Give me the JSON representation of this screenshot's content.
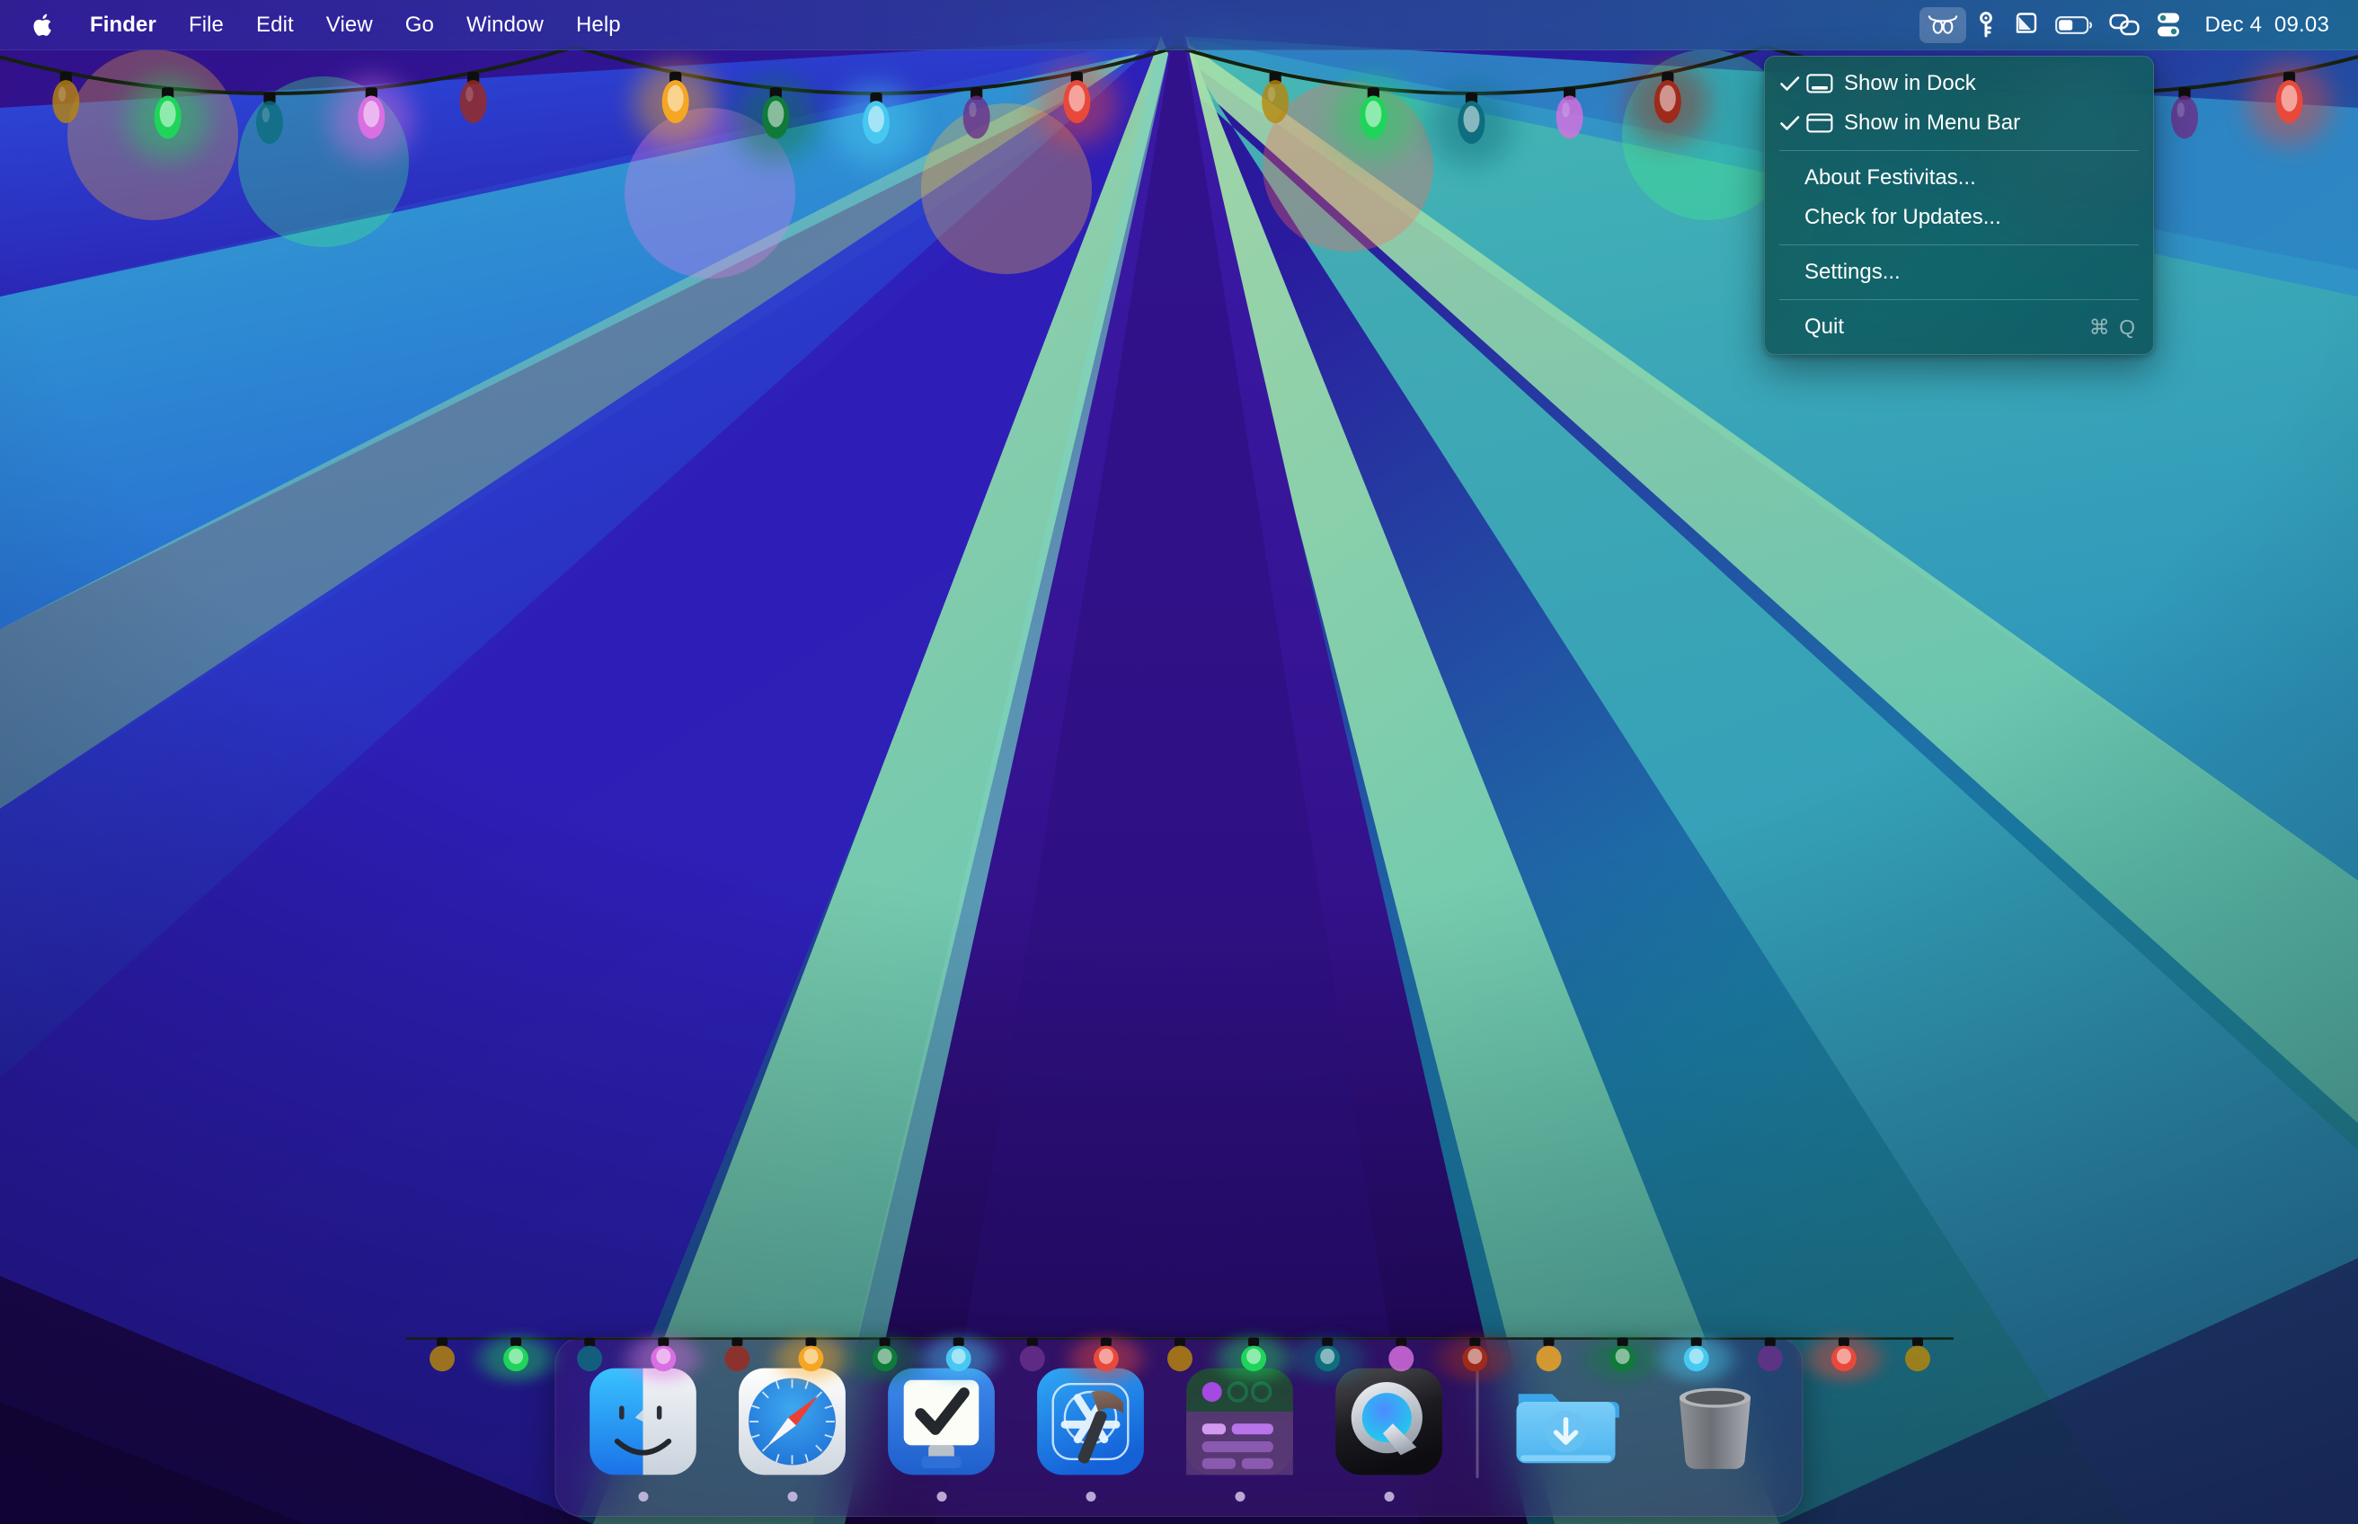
{
  "menubar": {
    "apple_icon": "apple-logo-icon",
    "items": [
      {
        "label": "Finder",
        "bold": true
      },
      {
        "label": "File",
        "bold": false
      },
      {
        "label": "Edit",
        "bold": false
      },
      {
        "label": "View",
        "bold": false
      },
      {
        "label": "Go",
        "bold": false
      },
      {
        "label": "Window",
        "bold": false
      },
      {
        "label": "Help",
        "bold": false
      }
    ],
    "status_items": [
      {
        "name": "festivitas-lights-icon",
        "active": true
      },
      {
        "name": "key-icon",
        "active": false
      },
      {
        "name": "pen-tip-icon",
        "active": false
      },
      {
        "name": "battery-icon",
        "active": false
      },
      {
        "name": "clipboard-link-icon",
        "active": false
      },
      {
        "name": "control-center-icon",
        "active": false
      }
    ],
    "clock": "Dec 4  09.03"
  },
  "festivitas_menu": {
    "items": [
      {
        "label": "Show in Dock",
        "checked": true,
        "glyph": "dock-glyph-icon",
        "shortcut": ""
      },
      {
        "label": "Show in Menu Bar",
        "checked": true,
        "glyph": "menubar-glyph-icon",
        "shortcut": ""
      },
      {
        "separator_after": true
      },
      {
        "label": "About Festivitas...",
        "checked": false,
        "glyph": "",
        "shortcut": ""
      },
      {
        "label": "Check for Updates...",
        "checked": false,
        "glyph": "",
        "shortcut": ""
      },
      {
        "separator_after": true
      },
      {
        "label": "Settings...",
        "checked": false,
        "glyph": "",
        "shortcut": ""
      },
      {
        "separator_after": true
      },
      {
        "label": "Quit",
        "checked": false,
        "glyph": "",
        "shortcut": "⌘ Q"
      }
    ]
  },
  "dock": {
    "apps": [
      {
        "name": "finder",
        "label": "Finder",
        "running": true
      },
      {
        "name": "safari",
        "label": "Safari",
        "running": true
      },
      {
        "name": "things",
        "label": "Things",
        "running": true
      },
      {
        "name": "xcode",
        "label": "Xcode",
        "running": true
      },
      {
        "name": "screenstudio",
        "label": "Screen Studio",
        "running": true
      },
      {
        "name": "quicktime",
        "label": "QuickTime Player",
        "running": true
      }
    ],
    "others": [
      {
        "name": "downloads-folder",
        "label": "Downloads",
        "running": false
      },
      {
        "name": "trash",
        "label": "Trash",
        "running": false
      }
    ]
  },
  "colors": {
    "menu_bg": "#14575c",
    "accent": "#3a9ad9",
    "wallpaper_deep_purple": "#2a0f5e",
    "wallpaper_blue": "#2b3fd6",
    "wallpaper_cyan": "#2aa7c8",
    "wallpaper_green": "#9bdba6",
    "wallpaper_teal": "#3fb8a6"
  },
  "lights": {
    "desktop_bulbs": [
      "#b8860b",
      "#1fd45a",
      "#0e6e7e",
      "#d96fe0",
      "#9e2a1c",
      "#f5a623",
      "#0f7a3a",
      "#46c8f0",
      "#6a2f8a",
      "#e8493a",
      "#b8860b",
      "#1fd45a",
      "#0e6e7e",
      "#d96fe0",
      "#9e2a1c",
      "#f5a623",
      "#0f7a3a",
      "#46c8f0",
      "#6a2f8a",
      "#e8493a",
      "#b8860b",
      "#1fd45a",
      "#0e6e7e",
      "#d96fe0",
      "#9e2a1c",
      "#f5a623",
      "#0f7a3a",
      "#46c8f0",
      "#6a2f8a",
      "#e8493a",
      "#b8860b",
      "#1fd45a"
    ],
    "dock_bulbs": [
      "#b8860b",
      "#1fd45a",
      "#0e6e7e",
      "#d96fe0",
      "#9e2a1c",
      "#f5a623",
      "#0f7a3a",
      "#46c8f0",
      "#6a2f8a",
      "#e8493a",
      "#b8860b",
      "#1fd45a",
      "#0e6e7e",
      "#d96fe0",
      "#9e2a1c",
      "#f5a623",
      "#0f7a3a",
      "#46c8f0",
      "#6a2f8a",
      "#e8493a",
      "#b8860b"
    ]
  }
}
